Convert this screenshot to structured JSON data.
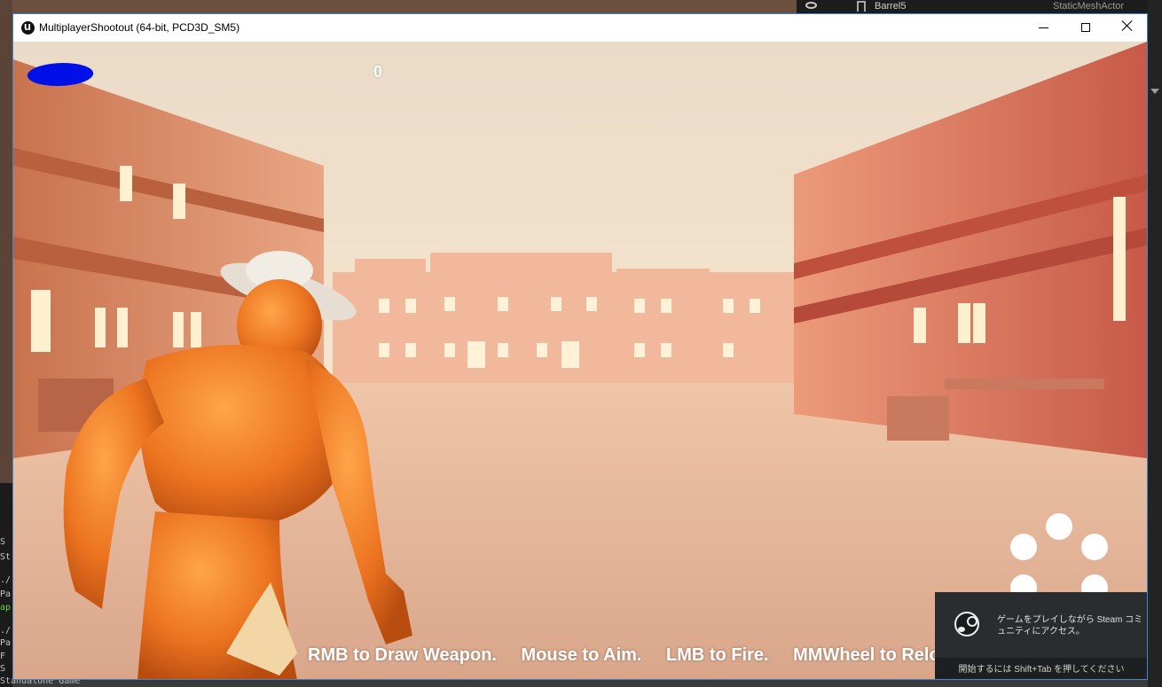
{
  "window": {
    "title": "MultiplayerShootout (64-bit, PCD3D_SM5)"
  },
  "editor": {
    "outliner_item_name": "Barrel5",
    "outliner_item_type": "StaticMeshActor",
    "console_lines": [
      "S",
      "St",
      "./",
      "Pa",
      "ap",
      "./",
      "Pa",
      "F",
      "S"
    ],
    "bottom_text": "Standalone Game"
  },
  "hud": {
    "score": "0",
    "controls": [
      "RMB to Draw Weapon.",
      "Mouse to Aim.",
      "LMB to Fire.",
      "MMWheel to Reload."
    ]
  },
  "steam_toast": {
    "message": "ゲームをプレイしながら Steam コミュニティにアクセス。",
    "hint": "開始するには Shift+Tab を押してください"
  },
  "colors": {
    "accent_border": "#3b87d7",
    "redaction": "#0010e6",
    "character": "#e8731e",
    "sky": "#f6e3cc"
  },
  "icons": {
    "app": "unreal-engine-logo-icon",
    "steam": "steam-logo-icon",
    "outliner_visibility": "eye-icon",
    "outliner_mesh": "static-mesh-icon"
  }
}
